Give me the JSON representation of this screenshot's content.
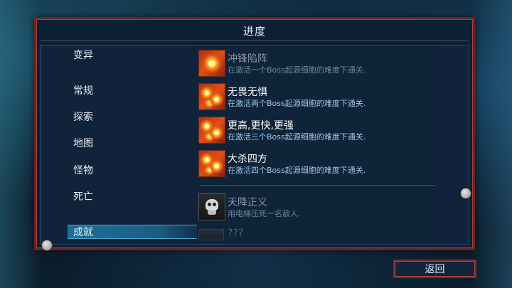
{
  "title": "进度",
  "categories": [
    {
      "label": "变异",
      "active": false
    },
    {
      "label": "常规",
      "active": false
    },
    {
      "label": "探索",
      "active": false
    },
    {
      "label": "地图",
      "active": false
    },
    {
      "label": "怪物",
      "active": false
    },
    {
      "label": "死亡",
      "active": false
    },
    {
      "label": "成就",
      "active": true
    }
  ],
  "achievements": [
    {
      "name": "冲锋陷阵",
      "desc": "在激活一个Boss起源细胞的难度下通关.",
      "unlocked": true,
      "icon": "flame-cell-icon"
    },
    {
      "name": "无畏无惧",
      "desc": "在激活两个Boss起源细胞的难度下通关.",
      "unlocked": true,
      "icon": "flame-cells-icon"
    },
    {
      "name": "更高,更快,更强",
      "desc": "在激活三个Boss起源细胞的难度下通关.",
      "unlocked": true,
      "icon": "flame-cells-icon"
    },
    {
      "name": "大杀四方",
      "desc": "在激活四个Boss起源细胞的难度下通关.",
      "unlocked": true,
      "icon": "flame-cells-icon"
    },
    {
      "name": "天降正义",
      "desc": "用电梯压死一名敌人.",
      "unlocked": false,
      "icon": "skull-icon"
    },
    {
      "name": "???",
      "desc": "",
      "unlocked": false,
      "icon": "locked-icon"
    }
  ],
  "back_label": "返回",
  "colors": {
    "frame": "#6a2326",
    "active_tab": "#1f6f9a",
    "desc_text": "#9fc7e8"
  }
}
